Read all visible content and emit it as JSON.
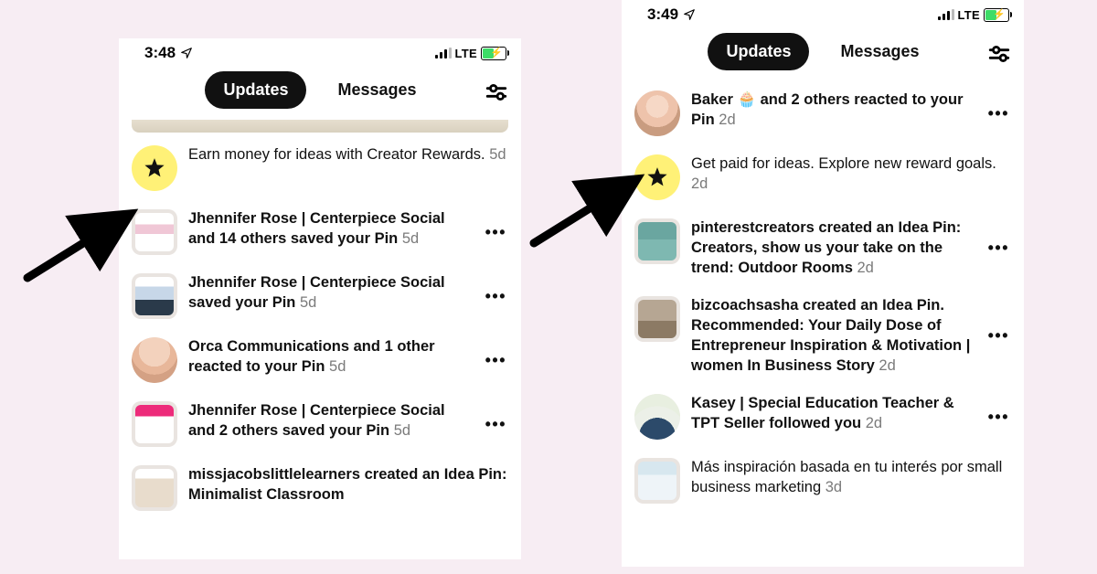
{
  "left": {
    "status_time": "3:48",
    "net_label": "LTE",
    "tabs": {
      "updates": "Updates",
      "messages": "Messages"
    },
    "items": [
      {
        "type": "star",
        "text_parts": [
          "Earn money for ideas with Creator Rewards."
        ],
        "time": "5d",
        "more": false
      },
      {
        "type": "pin",
        "thumb": "fake",
        "text_parts": [
          "",
          "Jhennifer Rose | Centerpiece Social",
          "",
          " and ",
          "",
          "14",
          "",
          " others saved your Pin"
        ],
        "time": "5d",
        "more": true
      },
      {
        "type": "pin",
        "thumb": "fake2",
        "text_parts": [
          "",
          "Jhennifer Rose | Centerpiece Social",
          "",
          " saved your Pin"
        ],
        "time": "5d",
        "more": true
      },
      {
        "type": "avatar",
        "thumb": "fake3",
        "text_parts": [
          "",
          "Orca Communications",
          "",
          " and ",
          "",
          "1",
          "",
          " other reacted to your Pin"
        ],
        "time": "5d",
        "more": true
      },
      {
        "type": "pin",
        "thumb": "fake4",
        "text_parts": [
          "",
          "Jhennifer Rose | Centerpiece Social",
          "",
          " and ",
          "",
          "2",
          "",
          " others saved your Pin"
        ],
        "time": "5d",
        "more": true
      },
      {
        "type": "pin",
        "thumb": "fake5",
        "text_parts": [
          "",
          "missjacobslittlelearners",
          "",
          " created an Idea Pin: Minimalist Classroom"
        ],
        "time": "",
        "more": false
      }
    ]
  },
  "right": {
    "status_time": "3:49",
    "net_label": "LTE",
    "tabs": {
      "updates": "Updates",
      "messages": "Messages"
    },
    "items": [
      {
        "type": "avatar",
        "thumb": "fake10",
        "text_parts": [
          "",
          "Baker",
          "",
          " 🧁 and ",
          "",
          "2",
          "",
          " others reacted to your Pin"
        ],
        "time": "2d",
        "more": true
      },
      {
        "type": "star",
        "text_parts": [
          "Get paid for ideas. Explore new reward goals."
        ],
        "time": "2d",
        "more": false
      },
      {
        "type": "pin",
        "thumb": "fake6",
        "text_parts": [
          "",
          "pinterestcreators",
          "",
          " created an Idea Pin: Creators, show us your take on the trend: Outdoor Rooms"
        ],
        "time": "2d",
        "more": true
      },
      {
        "type": "pin",
        "thumb": "fake7",
        "text_parts": [
          "",
          "bizcoachsasha",
          "",
          " created an Idea Pin. Recommended: Your Daily Dose of Entrepreneur Inspiration & Motivation | women In Business Story"
        ],
        "time": "2d",
        "more": true
      },
      {
        "type": "avatar",
        "thumb": "fake8",
        "text_parts": [
          "",
          "Kasey | Special Education Teacher & TPT Seller",
          "",
          " followed you"
        ],
        "time": "2d",
        "more": true
      },
      {
        "type": "pin",
        "thumb": "fake9",
        "text_parts": [
          "Más inspiración basada en tu interés por ",
          "",
          "small business marketing",
          ""
        ],
        "time": "3d",
        "more": false
      }
    ]
  }
}
